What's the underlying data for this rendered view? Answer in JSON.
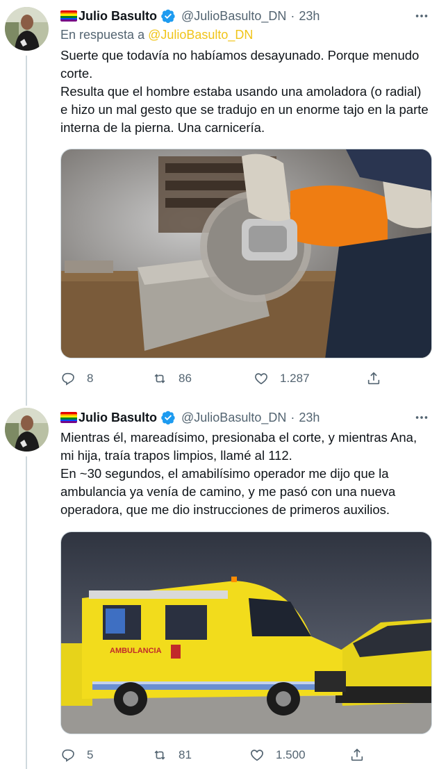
{
  "colors": {
    "text": "#0f1419",
    "secondary": "#536471",
    "mention": "#f0c419",
    "verified": "#1d9bf0",
    "line": "#cfd9de",
    "rainbow": [
      "#e40303",
      "#ff8c00",
      "#ffed00",
      "#008026",
      "#004dff",
      "#750787"
    ]
  },
  "tweets": [
    {
      "author": "Julio Basulto",
      "handle": "@JulioBasulto_DN",
      "separator": "·",
      "time": "23h",
      "reply_prefix": "En respuesta a",
      "reply_mention": "@JulioBasulto_DN",
      "paragraphs": [
        "Suerte que todavía no habíamos desayunado. Porque menudo corte.",
        "Resulta que el hombre estaba usando una amoladora (o radial) e hizo un mal gesto que se tradujo en un enorme tajo en la parte interna de la pierna. Una carnicería."
      ],
      "media_subject": "angle-grinder-cutting-block",
      "replies": "8",
      "retweets": "86",
      "likes": "1.287"
    },
    {
      "author": "Julio Basulto",
      "handle": "@JulioBasulto_DN",
      "separator": "·",
      "time": "23h",
      "paragraphs": [
        "Mientras él, mareadísimo, presionaba el corte, y mientras Ana, mi hija, traía trapos limpios, llamé al 112.",
        "En ~30 segundos, el amabilísimo operador me dijo que la ambulancia ya venía de camino, y me pasó con una nueva operadora, que me dio instrucciones de primeros auxilios."
      ],
      "media_subject": "yellow-ambulance-fleet",
      "ambulance_label": "AMBULANCIA",
      "replies": "5",
      "retweets": "81",
      "likes": "1.500"
    }
  ]
}
